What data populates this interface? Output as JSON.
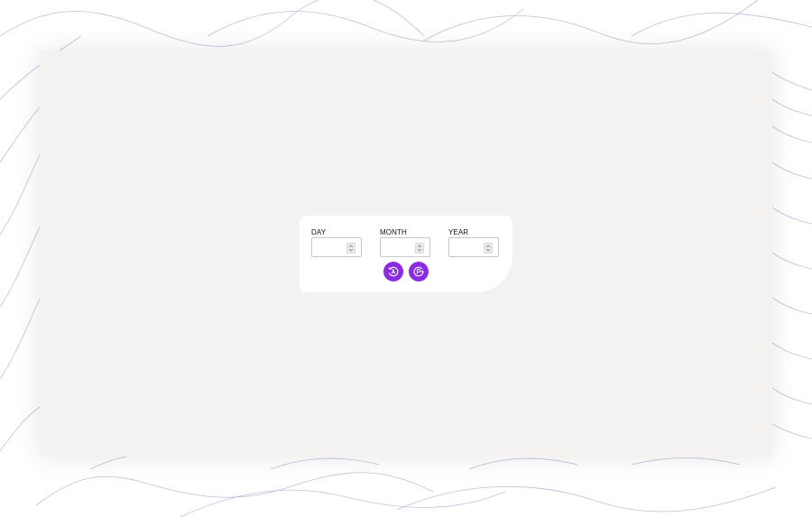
{
  "form": {
    "day": {
      "label": "DAY",
      "value": ""
    },
    "month": {
      "label": "MONTH",
      "value": ""
    },
    "year": {
      "label": "YEAR",
      "value": ""
    }
  },
  "buttons": [
    {
      "icon": "rotate-left-icon"
    },
    {
      "icon": "rotate-right-icon"
    }
  ],
  "colors": {
    "background": "#ffffff",
    "panel": "#f3f2f1",
    "card": "#ffffff",
    "accent": "#8a2be2",
    "wave_lines": "#b8c4dc"
  }
}
